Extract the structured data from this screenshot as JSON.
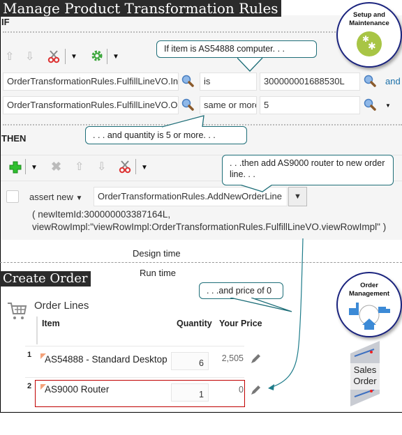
{
  "top_section": {
    "title": "Manage Product Transformation Rules",
    "if_label": "IF",
    "then_label": "THEN",
    "badge": {
      "label": "Setup and Maintenance",
      "icon": "gears-icon",
      "color": "#a8c545"
    }
  },
  "if_conditions": [
    {
      "attribute": "OrderTransformationRules.FulfillLineVO.Inv",
      "operator": "is",
      "value": "300000001688530L",
      "connector": "and"
    },
    {
      "attribute": "OrderTransformationRules.FulfillLineVO.Orc",
      "operator": "same or more",
      "value": "5",
      "connector_icon": "dropdown"
    }
  ],
  "then_action": {
    "mode": "assert new",
    "function": "OrderTransformationRules.AddNewOrderLine",
    "params_line1": "( newItemId:300000003387164L,",
    "params_line2": "viewRowImpl:\"viewRowImpl:OrderTransformationRules.FulfillLineVO.viewRowImpl\" )"
  },
  "callouts": {
    "item": "If item is AS54888 computer. . .",
    "quantity": ". . . and quantity is 5 or more. . .",
    "then_add": ". . .then add AS9000 router to new order line. . .",
    "price": ". . .and price of 0"
  },
  "divider": {
    "design_time": "Design time",
    "run_time": "Run time"
  },
  "bottom_section": {
    "title": "Create Order",
    "order_lines_title": "Order Lines",
    "columns": [
      "Item",
      "Quantity",
      "Your Price"
    ],
    "rows": [
      {
        "num": "1",
        "item": "AS54888 - Standard Desktop",
        "quantity": "6",
        "price": "2,505"
      },
      {
        "num": "2",
        "item": "AS9000 Router",
        "quantity": "1",
        "price": "0"
      }
    ],
    "badge": {
      "label_line1": "Order",
      "label_line2": "Management"
    },
    "sales_order": {
      "line1": "Sales",
      "line2": "Order"
    }
  },
  "colors": {
    "callout_border": "#1e6e78",
    "highlight": "#c00000",
    "link": "#1a6fa8",
    "title_bg": "#2b2b2b"
  }
}
